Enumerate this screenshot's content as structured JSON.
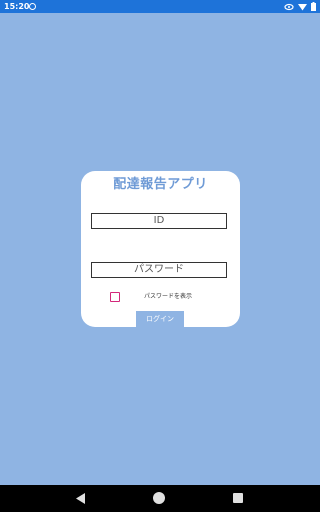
{
  "status_bar": {
    "time": "15:20",
    "icons": [
      "app-notification-icon",
      "vpn-key-icon",
      "wifi-icon",
      "battery-icon"
    ]
  },
  "login": {
    "title": "配達報告アプリ",
    "id_placeholder": "ID",
    "password_placeholder": "パスワード",
    "show_password_label": "パスワードを表示",
    "show_password_checked": false,
    "login_button": "ログイン"
  },
  "colors": {
    "background": "#8fb4e3",
    "status_bar": "#1e73d9",
    "title": "#6f9bd6",
    "checkbox_border": "#d3277a"
  },
  "nav_bar": {
    "buttons": [
      "back",
      "home",
      "recents"
    ]
  }
}
